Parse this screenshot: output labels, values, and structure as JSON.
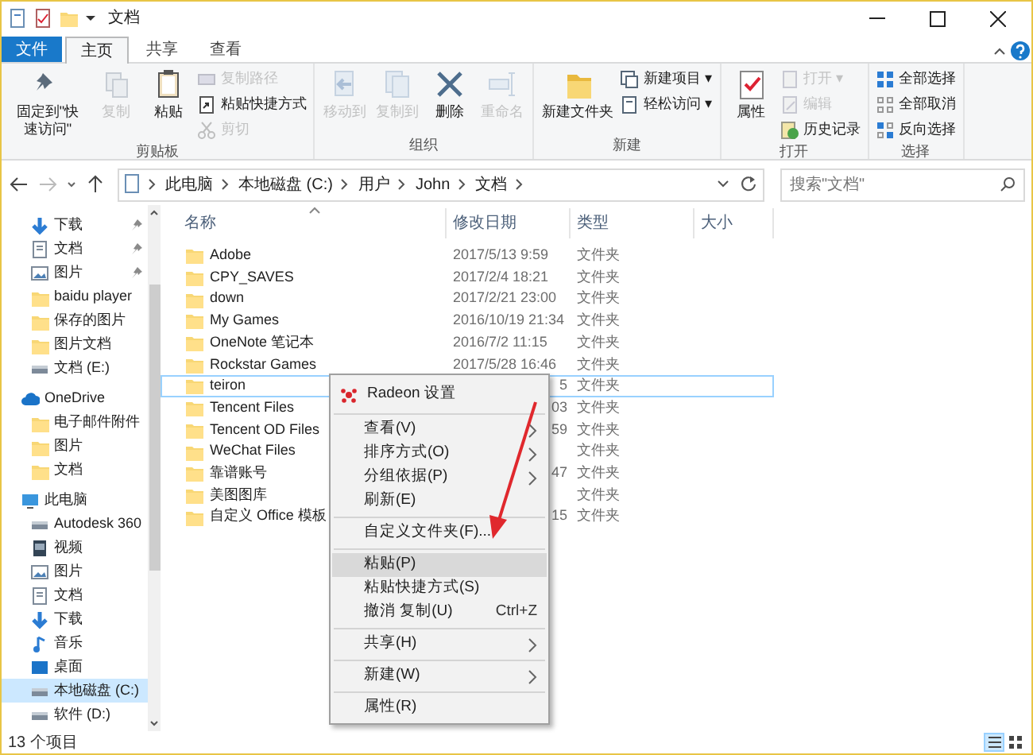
{
  "window": {
    "title": "文档"
  },
  "ribbon_tabs": [
    {
      "label": "文件",
      "kind": "file",
      "selected": false
    },
    {
      "label": "主页",
      "kind": "tab",
      "selected": true
    },
    {
      "label": "共享",
      "kind": "tab",
      "selected": false
    },
    {
      "label": "查看",
      "kind": "tab",
      "selected": false
    }
  ],
  "ribbon_groups": [
    {
      "label": "剪贴板",
      "buttons": [
        {
          "kind": "big",
          "label": "固定到\"快速访问\"",
          "disabled": false
        },
        {
          "kind": "big",
          "label": "复制",
          "disabled": true
        },
        {
          "kind": "big",
          "label": "粘贴",
          "disabled": false
        },
        {
          "kind": "small",
          "label": "复制路径",
          "disabled": true
        },
        {
          "kind": "small",
          "label": "粘贴快捷方式",
          "disabled": false
        },
        {
          "kind": "small",
          "label": "剪切",
          "disabled": true
        }
      ]
    },
    {
      "label": "组织",
      "buttons": [
        {
          "kind": "big",
          "label": "移动到",
          "disabled": true
        },
        {
          "kind": "big",
          "label": "复制到",
          "disabled": true
        },
        {
          "kind": "big",
          "label": "删除",
          "disabled": false
        },
        {
          "kind": "big",
          "label": "重命名",
          "disabled": true
        }
      ]
    },
    {
      "label": "新建",
      "buttons": [
        {
          "kind": "big",
          "label": "新建文件夹",
          "disabled": false
        },
        {
          "kind": "small",
          "label": "新建项目 ▾",
          "disabled": false
        },
        {
          "kind": "small",
          "label": "轻松访问 ▾",
          "disabled": false
        }
      ]
    },
    {
      "label": "打开",
      "buttons": [
        {
          "kind": "big",
          "label": "属性",
          "disabled": false
        },
        {
          "kind": "small",
          "label": "打开 ▾",
          "disabled": true
        },
        {
          "kind": "small",
          "label": "编辑",
          "disabled": true
        },
        {
          "kind": "small",
          "label": "历史记录",
          "disabled": false
        }
      ]
    },
    {
      "label": "选择",
      "buttons": [
        {
          "kind": "small",
          "label": "全部选择",
          "disabled": false
        },
        {
          "kind": "small",
          "label": "全部取消",
          "disabled": false
        },
        {
          "kind": "small",
          "label": "反向选择",
          "disabled": false
        }
      ]
    }
  ],
  "address": {
    "segments": [
      "此电脑",
      "本地磁盘 (C:)",
      "用户",
      "John",
      "文档"
    ]
  },
  "search": {
    "placeholder": "搜索\"文档\""
  },
  "sidebar": {
    "items": [
      {
        "label": "下载",
        "kind": "download",
        "pinned": true,
        "selected": false
      },
      {
        "label": "文档",
        "kind": "document",
        "pinned": true,
        "selected": false
      },
      {
        "label": "图片",
        "kind": "picture",
        "pinned": true,
        "selected": false
      },
      {
        "label": "baidu player",
        "kind": "folder",
        "pinned": false,
        "selected": false
      },
      {
        "label": "保存的图片",
        "kind": "folder",
        "pinned": false,
        "selected": false
      },
      {
        "label": "图片文档",
        "kind": "folder",
        "pinned": false,
        "selected": false
      },
      {
        "label": "文档 (E:)",
        "kind": "drive",
        "pinned": false,
        "selected": false
      },
      {
        "label": "OneDrive",
        "kind": "cloud",
        "pinned": false,
        "selected": false,
        "children": [
          {
            "label": "电子邮件附件",
            "kind": "folder",
            "pinned": false,
            "selected": false
          },
          {
            "label": "图片",
            "kind": "folder",
            "pinned": false,
            "selected": false
          },
          {
            "label": "文档",
            "kind": "folder",
            "pinned": false,
            "selected": false
          }
        ]
      },
      {
        "label": "此电脑",
        "kind": "pc",
        "pinned": false,
        "selected": false,
        "children": [
          {
            "label": "Autodesk 360",
            "kind": "drive",
            "pinned": false,
            "selected": false
          },
          {
            "label": "视频",
            "kind": "video",
            "pinned": false,
            "selected": false
          },
          {
            "label": "图片",
            "kind": "picture",
            "pinned": false,
            "selected": false
          },
          {
            "label": "文档",
            "kind": "document",
            "pinned": false,
            "selected": false
          },
          {
            "label": "下载",
            "kind": "download",
            "pinned": false,
            "selected": false
          },
          {
            "label": "音乐",
            "kind": "music",
            "pinned": false,
            "selected": false
          },
          {
            "label": "桌面",
            "kind": "desktop",
            "pinned": false,
            "selected": false
          },
          {
            "label": "本地磁盘 (C:)",
            "kind": "drive",
            "pinned": false,
            "selected": true
          },
          {
            "label": "软件 (D:)",
            "kind": "drive",
            "pinned": false,
            "selected": false
          }
        ]
      }
    ]
  },
  "table": {
    "columns": [
      "名称",
      "修改日期",
      "类型",
      "大小"
    ],
    "rows": [
      {
        "name": "Adobe",
        "date": "2017/5/13 9:59",
        "type": "文件夹",
        "kind": "full",
        "focused": false
      },
      {
        "name": "CPY_SAVES",
        "date": "2017/2/4 18:21",
        "type": "文件夹",
        "kind": "full",
        "focused": false
      },
      {
        "name": "down",
        "date": "2017/2/21 23:00",
        "type": "文件夹",
        "kind": "full",
        "focused": false
      },
      {
        "name": "My Games",
        "date": "2016/10/19 21:34",
        "type": "文件夹",
        "kind": "full",
        "focused": false
      },
      {
        "name": "OneNote 笔记本",
        "date": "2016/7/2 11:15",
        "type": "文件夹",
        "kind": "full",
        "focused": false
      },
      {
        "name": "Rockstar Games",
        "date": "2017/5/28 16:46",
        "type": "文件夹",
        "kind": "full",
        "focused": false
      },
      {
        "name": "teiron",
        "date": "5",
        "type": "文件夹",
        "kind": "covered",
        "focused": true
      },
      {
        "name": "Tencent Files",
        "date": "03",
        "type": "文件夹",
        "kind": "covered",
        "focused": false
      },
      {
        "name": "Tencent OD Files",
        "date": "59",
        "type": "文件夹",
        "kind": "covered",
        "focused": false
      },
      {
        "name": "WeChat Files",
        "type": "文件夹",
        "kind": "covered",
        "focused": false
      },
      {
        "name": "靠谱账号",
        "date": "47",
        "type": "文件夹",
        "kind": "covered",
        "focused": false
      },
      {
        "name": "美图图库",
        "type": "文件夹",
        "kind": "covered",
        "focused": false
      },
      {
        "name": "自定义 Office 模板",
        "date": "15",
        "type": "文件夹",
        "kind": "covered",
        "focused": false
      }
    ]
  },
  "context_menu": {
    "items": [
      {
        "kind": "header",
        "label": "Radeon 设置",
        "highlighted": false
      },
      {
        "kind": "separator"
      },
      {
        "kind": "submenu",
        "label": "查看(V)",
        "highlighted": false
      },
      {
        "kind": "submenu",
        "label": "排序方式(O)",
        "highlighted": false
      },
      {
        "kind": "submenu",
        "label": "分组依据(P)",
        "highlighted": false
      },
      {
        "kind": "item",
        "label": "刷新(E)",
        "highlighted": false
      },
      {
        "kind": "separator"
      },
      {
        "kind": "item",
        "label": "自定义文件夹(F)...",
        "highlighted": false
      },
      {
        "kind": "separator"
      },
      {
        "kind": "item",
        "label": "粘贴(P)",
        "highlighted": true
      },
      {
        "kind": "item",
        "label": "粘贴快捷方式(S)",
        "highlighted": false
      },
      {
        "kind": "item",
        "label": "撤消 复制(U)",
        "shortcut": "Ctrl+Z",
        "highlighted": false
      },
      {
        "kind": "separator"
      },
      {
        "kind": "submenu",
        "label": "共享(H)",
        "highlighted": false
      },
      {
        "kind": "separator"
      },
      {
        "kind": "submenu",
        "label": "新建(W)",
        "highlighted": false
      },
      {
        "kind": "separator"
      },
      {
        "kind": "item",
        "label": "属性(R)",
        "highlighted": false
      }
    ]
  },
  "status_bar": {
    "text": "13 个项目",
    "views": [
      {
        "kind": "details",
        "selected": true
      },
      {
        "kind": "icons",
        "selected": false
      }
    ]
  }
}
